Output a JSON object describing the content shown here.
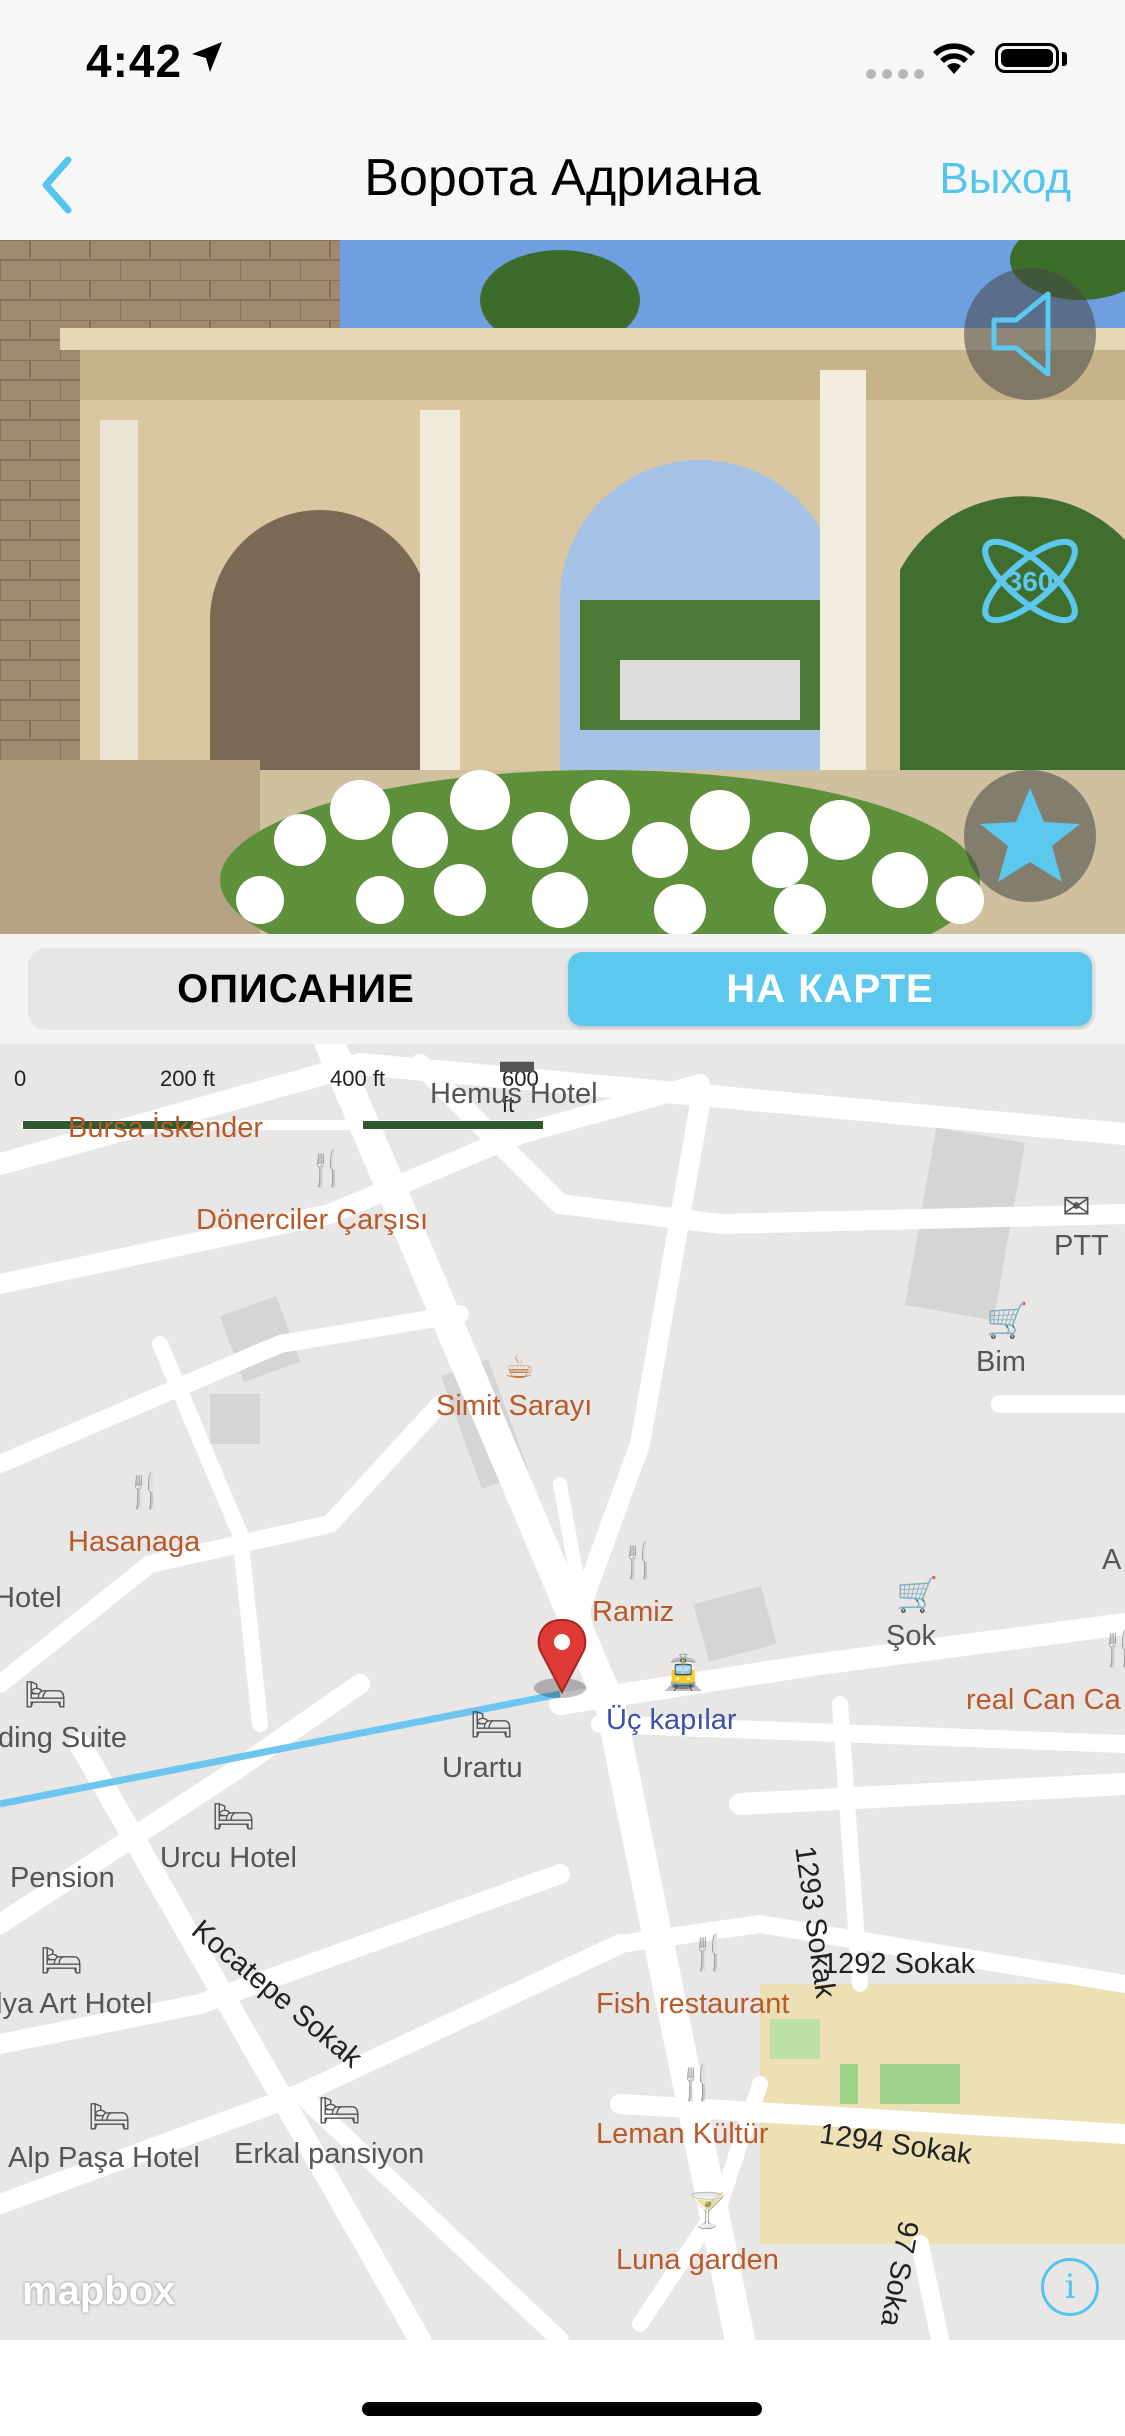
{
  "status_bar": {
    "time": "4:42"
  },
  "nav": {
    "title": "Ворота Адриана",
    "exit_label": "Выход"
  },
  "hero": {
    "buttons": [
      "speaker-icon",
      "panorama-360-icon",
      "favorite-star-icon"
    ],
    "pano_label": "360"
  },
  "segments": {
    "description_label": "ОПИСАНИЕ",
    "map_label": "НА КАРТЕ",
    "selected": "map"
  },
  "map": {
    "scale": [
      "0",
      "200 ft",
      "400 ft",
      "600 ft"
    ],
    "labels": {
      "bursa": "Bursa İskender",
      "hemus": "Hemus Hotel",
      "donerciler": "Dönerciler Çarşısı",
      "ptt": "PTT",
      "bim": "Bim",
      "simit": "Simit Sarayı",
      "hasanaga": "Hasanaga",
      "ramiz": "Ramiz",
      "sok": "Şok",
      "hotel_left": "Hotel",
      "realcan": "real Can Ca",
      "ding_suite": "ding Suite",
      "uc_kapilar": "Üç kapılar",
      "urartu": "Urartu",
      "pension": "Pension",
      "urcu": "Urcu Hotel",
      "street_1293": "1293 Sokak",
      "kocatepe": "Kocatepe Sokak",
      "lya_art": "lya Art Hotel",
      "fish": "Fish restaurant",
      "street_1292": "1292 Sokak",
      "leman": "Leman Kültür",
      "street_1294": "1294 Sokak",
      "alp": "Alp Paşa Hotel",
      "erkal": "Erkal pansiyon",
      "luna": "Luna garden",
      "street_97": "97 Soka",
      "edge_a": "A"
    },
    "attribution": "mapbox",
    "info_label": "i"
  },
  "colors": {
    "accent": "#53c5ef",
    "segment_active": "#5cc8ee",
    "poi": "#b75b2c",
    "pin": "#e03a36",
    "route": "#6cc6ee"
  }
}
